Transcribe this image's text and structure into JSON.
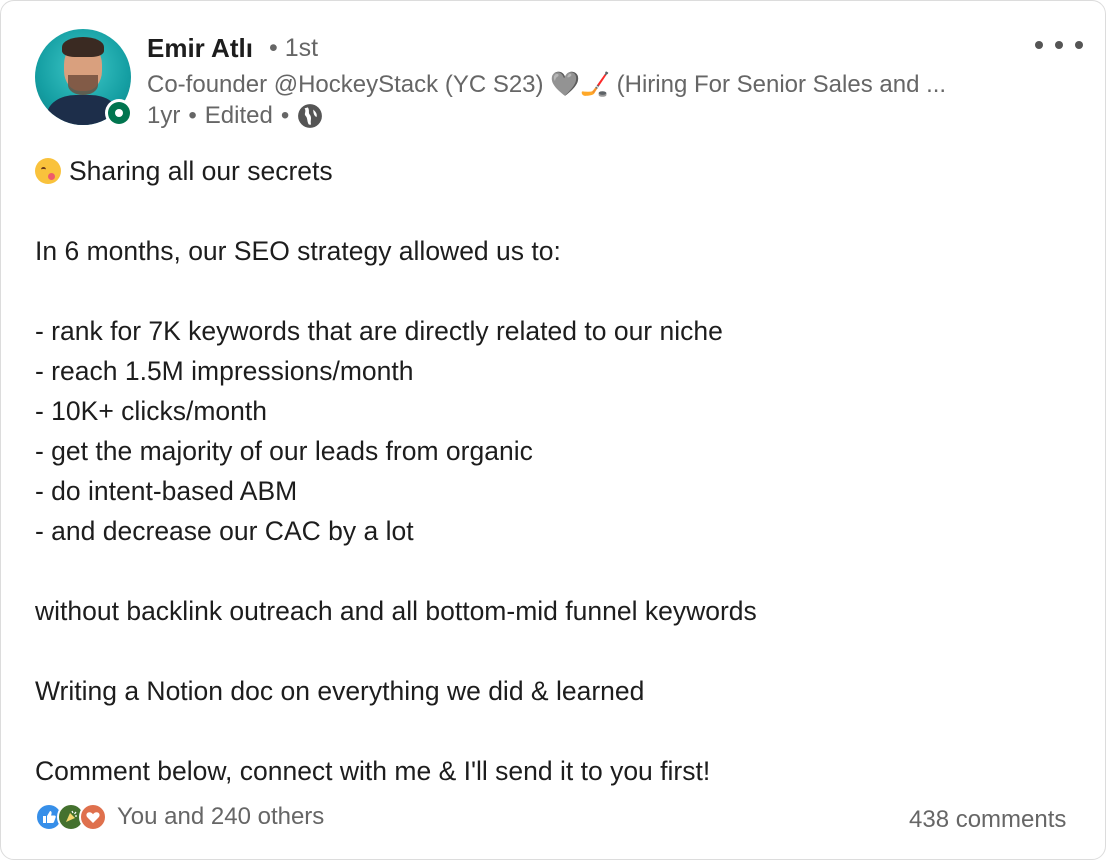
{
  "post": {
    "author": {
      "name": "Emir Atlı",
      "degree": "• 1st",
      "headline": "Co-founder @HockeyStack (YC S23) 🩶🏒 (Hiring For Senior Sales and ...",
      "time": "1yr",
      "edited": "Edited",
      "visibility_icon": "globe-icon"
    },
    "text_lines": [
      "Sharing all our secrets",
      "",
      "In 6 months, our SEO strategy allowed us to:",
      "",
      "- rank for 7K keywords that are directly related to our niche",
      "- reach 1.5M impressions/month",
      "- 10K+ clicks/month",
      "- get the majority of our leads from organic",
      "- do intent-based ABM",
      "- and decrease our CAC by a lot",
      "",
      "without backlink outreach and all bottom-mid funnel keywords",
      "",
      "Writing a Notion doc on everything we did & learned",
      "",
      "Comment below, connect with me & I'll send it to you first!"
    ],
    "social": {
      "reactions_text": "You and 240 others",
      "comments_text": "438 comments",
      "reaction_icons": [
        "like-icon",
        "celebrate-icon",
        "love-icon"
      ]
    },
    "colors": {
      "presence_green": "#01754f",
      "like_blue": "#378fe9",
      "celebrate_green": "#44712e",
      "love_orange": "#df704d",
      "muted_text": "#666666"
    }
  }
}
